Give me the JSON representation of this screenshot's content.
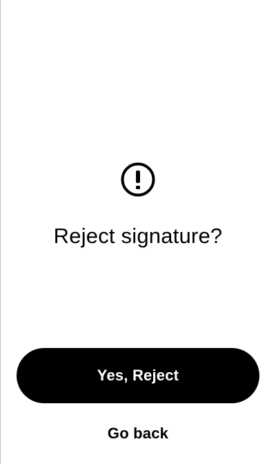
{
  "dialog": {
    "icon": "exclamation-circle-icon",
    "title": "Reject signature?"
  },
  "actions": {
    "confirm_label": "Yes, Reject",
    "cancel_label": "Go back"
  },
  "colors": {
    "background": "#ffffff",
    "primary_button": "#000000",
    "primary_button_text": "#ffffff",
    "text": "#000000"
  }
}
